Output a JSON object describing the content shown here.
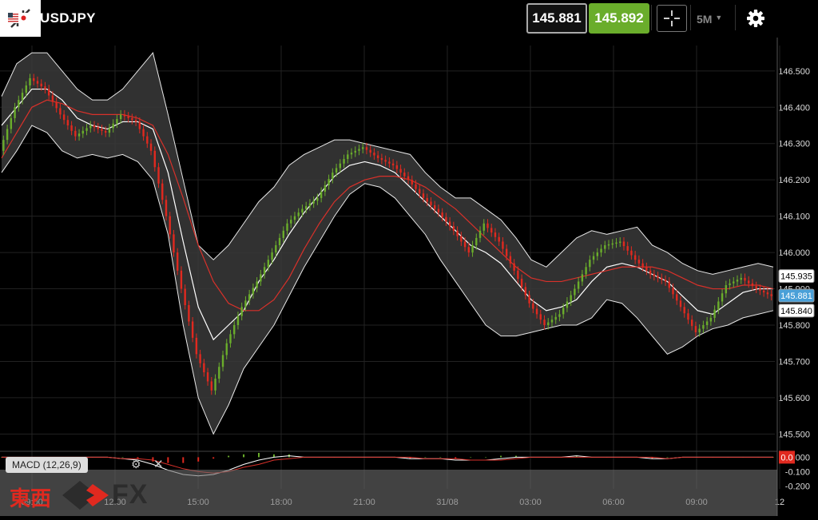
{
  "header": {
    "symbol": "USDJPY",
    "bid": "145.881",
    "ask": "145.892",
    "timeframe": "5M",
    "flag_icon": "us-jp-flag-icon",
    "crosshair_icon": "crosshair-icon",
    "settings_icon": "gear-icon",
    "shrink_icon": "shrink-icon"
  },
  "macd_label": "MACD (12,26,9)",
  "watermark": "東西FX",
  "colors": {
    "background": "#000000",
    "up_candle": "#6aad2b",
    "down_candle": "#e0291f",
    "bollinger_band": "#3a3a3a",
    "moving_average": "#d8312a",
    "bid_badge": "#4aa0d8",
    "macd_signal": "#d8312a"
  },
  "chart_data": [
    {
      "type": "line",
      "ylim": [
        145.47,
        146.57
      ],
      "y_ticks": [
        "146.500",
        "146.400",
        "146.300",
        "146.200",
        "146.100",
        "146.000",
        "145.900",
        "145.800",
        "145.700",
        "145.600",
        "145.500"
      ],
      "y_tick_values": [
        146.5,
        146.4,
        146.3,
        146.2,
        146.1,
        146.0,
        145.9,
        145.8,
        145.7,
        145.6,
        145.5
      ],
      "x_ticks": [
        "09:00",
        "12:00",
        "15:00",
        "18:00",
        "21:00",
        "31/08",
        "03:00",
        "06:00",
        "09:00",
        "12"
      ],
      "price_badges": [
        {
          "label": "145.935",
          "value": 145.935,
          "style": "outline"
        },
        {
          "label": "145.881",
          "value": 145.881,
          "style": "bid"
        },
        {
          "label": "145.840",
          "value": 145.84,
          "style": "outline"
        }
      ],
      "series": [
        {
          "key": "price",
          "values": [
            146.28,
            146.4,
            146.48,
            146.45,
            146.38,
            146.32,
            146.35,
            146.33,
            146.38,
            146.36,
            146.28,
            146.1,
            145.9,
            145.72,
            145.62,
            145.75,
            145.85,
            145.92,
            146.0,
            146.08,
            146.12,
            146.15,
            146.22,
            146.27,
            146.29,
            146.26,
            146.24,
            146.2,
            146.15,
            146.11,
            146.06,
            146.0,
            146.08,
            146.03,
            145.95,
            145.86,
            145.8,
            145.83,
            145.9,
            145.98,
            146.02,
            146.03,
            145.98,
            145.94,
            145.92,
            145.85,
            145.78,
            145.82,
            145.91,
            145.93,
            145.9,
            145.88
          ]
        },
        {
          "key": "ma",
          "values": [
            146.26,
            146.33,
            146.4,
            146.42,
            146.41,
            146.39,
            146.38,
            146.38,
            146.38,
            146.37,
            146.35,
            146.27,
            146.15,
            146.02,
            145.92,
            145.86,
            145.84,
            145.84,
            145.87,
            145.93,
            146.01,
            146.08,
            146.14,
            146.18,
            146.2,
            146.21,
            146.21,
            146.2,
            146.18,
            146.15,
            146.12,
            146.08,
            146.04,
            146.0,
            145.96,
            145.93,
            145.92,
            145.92,
            145.93,
            145.94,
            145.95,
            145.96,
            145.96,
            145.96,
            145.95,
            145.93,
            145.91,
            145.9,
            145.9,
            145.91,
            145.91,
            145.9
          ]
        },
        {
          "key": "mid",
          "values": [
            146.35,
            146.4,
            146.45,
            146.45,
            146.42,
            146.37,
            146.35,
            146.34,
            146.36,
            146.36,
            146.34,
            146.22,
            146.03,
            145.85,
            145.76,
            145.8,
            145.84,
            145.92,
            145.98,
            146.05,
            146.11,
            146.16,
            146.21,
            146.24,
            146.25,
            146.24,
            146.22,
            146.18,
            146.14,
            146.1,
            146.06,
            146.02,
            146.0,
            145.97,
            145.92,
            145.87,
            145.84,
            145.85,
            145.87,
            145.92,
            145.96,
            145.97,
            145.96,
            145.94,
            145.92,
            145.88,
            145.84,
            145.83,
            145.86,
            145.89,
            145.9,
            145.9
          ]
        },
        {
          "key": "upper",
          "values": [
            146.43,
            146.52,
            146.55,
            146.55,
            146.5,
            146.45,
            146.42,
            146.42,
            146.45,
            146.5,
            146.55,
            146.38,
            146.2,
            146.02,
            145.98,
            146.02,
            146.08,
            146.14,
            146.18,
            146.24,
            146.27,
            146.29,
            146.31,
            146.31,
            146.3,
            146.29,
            146.28,
            146.27,
            146.22,
            146.18,
            146.15,
            146.15,
            146.12,
            146.09,
            146.04,
            145.98,
            145.96,
            146.0,
            146.04,
            146.06,
            146.05,
            146.06,
            146.07,
            146.02,
            146.0,
            145.97,
            145.95,
            145.94,
            145.95,
            145.96,
            145.97,
            145.96
          ]
        },
        {
          "key": "lower",
          "values": [
            146.22,
            146.28,
            146.35,
            146.33,
            146.28,
            146.26,
            146.27,
            146.26,
            146.27,
            146.25,
            146.2,
            146.05,
            145.8,
            145.6,
            145.5,
            145.58,
            145.68,
            145.74,
            145.8,
            145.88,
            145.96,
            146.03,
            146.1,
            146.16,
            146.19,
            146.18,
            146.15,
            146.1,
            146.05,
            145.98,
            145.92,
            145.86,
            145.8,
            145.77,
            145.77,
            145.78,
            145.79,
            145.8,
            145.8,
            145.82,
            145.87,
            145.86,
            145.82,
            145.77,
            145.72,
            145.74,
            145.77,
            145.79,
            145.8,
            145.82,
            145.83,
            145.84
          ]
        }
      ]
    },
    {
      "type": "line",
      "ylim": [
        -0.22,
        0.03
      ],
      "y_ticks": [
        "0.000",
        "-0.100",
        "-0.200"
      ],
      "y_tick_values": [
        0.0,
        -0.1,
        -0.2
      ],
      "badge": {
        "label": "0.0",
        "value": 0.0
      },
      "series": [
        {
          "key": "macd",
          "values": [
            0.0,
            0.0,
            0.0,
            0.0,
            0.0,
            0.0,
            0.0,
            0.0,
            -0.01,
            -0.02,
            -0.05,
            -0.09,
            -0.12,
            -0.13,
            -0.12,
            -0.09,
            -0.05,
            -0.02,
            0.0,
            0.01,
            0.0,
            0.0,
            0.0,
            0.0,
            0.0,
            0.0,
            0.0,
            -0.01,
            -0.01,
            -0.01,
            -0.02,
            -0.02,
            -0.02,
            -0.01,
            0.0,
            0.0,
            0.0,
            0.0,
            0.01,
            0.0,
            0.0,
            0.0,
            0.0,
            -0.01,
            -0.01,
            0.0,
            0.0,
            0.0,
            0.0,
            0.0,
            0.0,
            0.0
          ]
        },
        {
          "key": "signal",
          "values": [
            0.0,
            0.0,
            0.0,
            0.0,
            0.0,
            0.0,
            0.0,
            0.0,
            -0.01,
            -0.01,
            -0.02,
            -0.05,
            -0.08,
            -0.1,
            -0.11,
            -0.1,
            -0.07,
            -0.05,
            -0.02,
            -0.01,
            0.0,
            0.0,
            0.0,
            0.0,
            0.0,
            0.0,
            0.0,
            0.0,
            -0.01,
            -0.01,
            -0.01,
            -0.02,
            -0.02,
            -0.02,
            -0.01,
            0.0,
            0.0,
            0.0,
            0.0,
            0.0,
            0.0,
            0.0,
            0.0,
            0.0,
            -0.01,
            0.0,
            0.0,
            0.0,
            0.0,
            0.0,
            0.0,
            0.0
          ]
        }
      ]
    }
  ]
}
